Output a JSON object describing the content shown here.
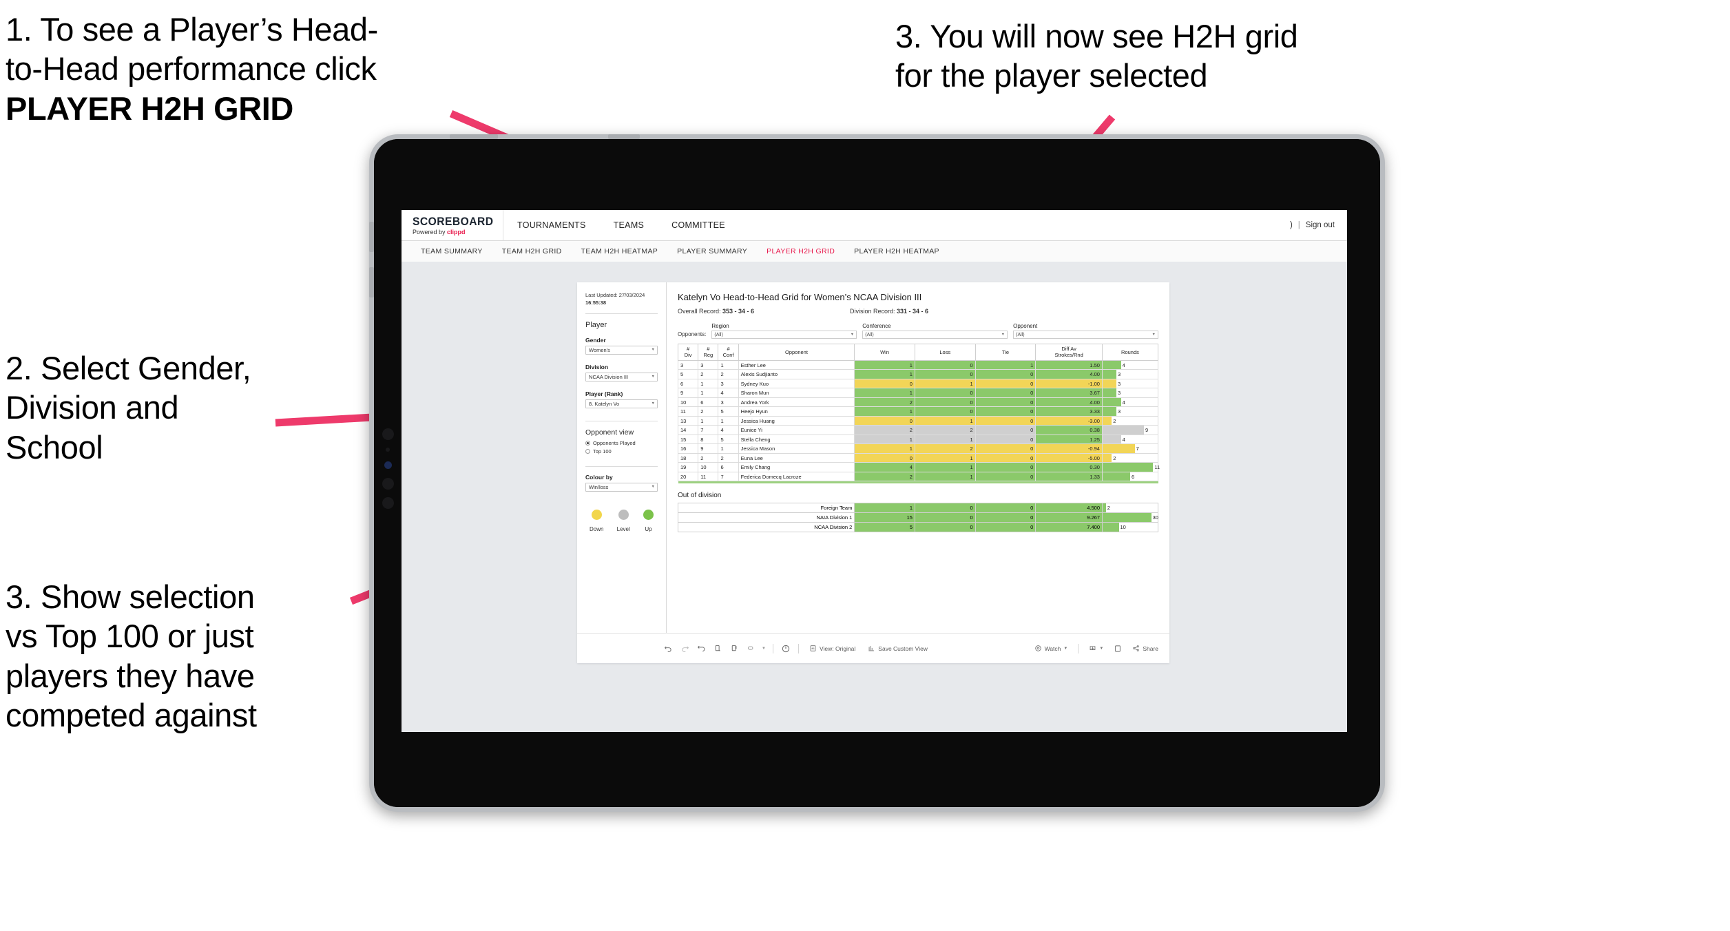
{
  "annotations": {
    "a1_line1": "1. To see a Player’s Head-",
    "a1_line2": "to-Head performance click",
    "a1_bold": "PLAYER H2H GRID",
    "a2": "2. Select Gender,\nDivision and\nSchool",
    "a3": "3. Show selection\nvs Top 100 or just\nplayers they have\ncompeted against",
    "a4": "3. You will now see H2H grid\nfor the player selected",
    "arrow_color": "#EE3A6B"
  },
  "app": {
    "logo": {
      "main": "SCOREBOARD",
      "powered": "Powered by ",
      "brand": "clippd"
    },
    "topnav": [
      {
        "label": "TOURNAMENTS"
      },
      {
        "label": "TEAMS"
      },
      {
        "label": "COMMITTEE"
      }
    ],
    "account": {
      "name": ")",
      "separator": "|",
      "signout": "Sign out"
    },
    "subnav": [
      {
        "label": "TEAM SUMMARY",
        "active": false
      },
      {
        "label": "TEAM H2H GRID",
        "active": false
      },
      {
        "label": "TEAM H2H HEATMAP",
        "active": false
      },
      {
        "label": "PLAYER SUMMARY",
        "active": false
      },
      {
        "label": "PLAYER H2H GRID",
        "active": true
      },
      {
        "label": "PLAYER H2H HEATMAP",
        "active": false
      }
    ]
  },
  "sidebar": {
    "last_updated_label": "Last Updated: 27/03/2024",
    "last_updated_time": "16:55:38",
    "player_heading": "Player",
    "gender_label": "Gender",
    "gender_value": "Women's",
    "division_label": "Division",
    "division_value": "NCAA Division III",
    "player_rank_label": "Player (Rank)",
    "player_rank_value": "8. Katelyn Vo",
    "opponent_view_heading": "Opponent view",
    "opponent_view_options": [
      {
        "label": "Opponents Played",
        "selected": true
      },
      {
        "label": "Top 100",
        "selected": false
      }
    ],
    "colour_by_label": "Colour by",
    "colour_by_value": "Win/loss",
    "legend": [
      {
        "label": "Down",
        "color": "#F2D64B"
      },
      {
        "label": "Level",
        "color": "#BDBDBD"
      },
      {
        "label": "Up",
        "color": "#7BC24A"
      }
    ]
  },
  "viz": {
    "title": "Katelyn Vo Head-to-Head Grid for Women’s NCAA Division III",
    "overall_record_label": "Overall Record: ",
    "overall_record_value": "353 - 34 - 6",
    "division_record_label": "Division Record: ",
    "division_record_value": "331 - 34 - 6",
    "opponents_label": "Opponents:",
    "filters": [
      {
        "label": "Region",
        "value": "(All)"
      },
      {
        "label": "Conference",
        "value": "(All)"
      },
      {
        "label": "Opponent",
        "value": "(All)"
      }
    ],
    "out_of_division_title": "Out of division"
  },
  "chart_data": {
    "type": "table",
    "title": "Katelyn Vo Head-to-Head Grid for Women’s NCAA Division III",
    "columns": [
      "# Div",
      "# Reg",
      "# Conf",
      "Opponent",
      "Win",
      "Loss",
      "Tie",
      "Diff Av Strokes/Rnd",
      "Rounds"
    ],
    "rounds_max": 12,
    "rows": [
      {
        "div": "3",
        "reg": "3",
        "conf": "1",
        "opponent": "Esther Lee",
        "win": "1",
        "loss": "0",
        "tie": "1",
        "diff": "1.50",
        "rounds": "4",
        "state": "up"
      },
      {
        "div": "5",
        "reg": "2",
        "conf": "2",
        "opponent": "Alexis Sudjianto",
        "win": "1",
        "loss": "0",
        "tie": "0",
        "diff": "4.00",
        "rounds": "3",
        "state": "up"
      },
      {
        "div": "6",
        "reg": "1",
        "conf": "3",
        "opponent": "Sydney Kuo",
        "win": "0",
        "loss": "1",
        "tie": "0",
        "diff": "-1.00",
        "rounds": "3",
        "state": "down"
      },
      {
        "div": "9",
        "reg": "1",
        "conf": "4",
        "opponent": "Sharon Mun",
        "win": "1",
        "loss": "0",
        "tie": "0",
        "diff": "3.67",
        "rounds": "3",
        "state": "up"
      },
      {
        "div": "10",
        "reg": "6",
        "conf": "3",
        "opponent": "Andrea York",
        "win": "2",
        "loss": "0",
        "tie": "0",
        "diff": "4.00",
        "rounds": "4",
        "state": "up"
      },
      {
        "div": "11",
        "reg": "2",
        "conf": "5",
        "opponent": "Heejo Hyun",
        "win": "1",
        "loss": "0",
        "tie": "0",
        "diff": "3.33",
        "rounds": "3",
        "state": "up"
      },
      {
        "div": "13",
        "reg": "1",
        "conf": "1",
        "opponent": "Jessica Huang",
        "win": "0",
        "loss": "1",
        "tie": "0",
        "diff": "-3.00",
        "rounds": "2",
        "state": "down"
      },
      {
        "div": "14",
        "reg": "7",
        "conf": "4",
        "opponent": "Eunice Yi",
        "win": "2",
        "loss": "2",
        "tie": "0",
        "diff": "0.38",
        "rounds": "9",
        "state": "level"
      },
      {
        "div": "15",
        "reg": "8",
        "conf": "5",
        "opponent": "Stella Cheng",
        "win": "1",
        "loss": "1",
        "tie": "0",
        "diff": "1.25",
        "rounds": "4",
        "state": "level"
      },
      {
        "div": "16",
        "reg": "9",
        "conf": "1",
        "opponent": "Jessica Mason",
        "win": "1",
        "loss": "2",
        "tie": "0",
        "diff": "-0.94",
        "rounds": "7",
        "state": "down"
      },
      {
        "div": "18",
        "reg": "2",
        "conf": "2",
        "opponent": "Euna Lee",
        "win": "0",
        "loss": "1",
        "tie": "0",
        "diff": "-5.00",
        "rounds": "2",
        "state": "down"
      },
      {
        "div": "19",
        "reg": "10",
        "conf": "6",
        "opponent": "Emily Chang",
        "win": "4",
        "loss": "1",
        "tie": "0",
        "diff": "0.30",
        "rounds": "11",
        "state": "up"
      },
      {
        "div": "20",
        "reg": "11",
        "conf": "7",
        "opponent": "Federica Domecq Lacroze",
        "win": "2",
        "loss": "1",
        "tie": "0",
        "diff": "1.33",
        "rounds": "6",
        "state": "up"
      }
    ],
    "out_of_division": [
      {
        "name": "Foreign Team",
        "win": "1",
        "loss": "0",
        "tie": "0",
        "diff": "4.500",
        "rounds": "2",
        "state": "up"
      },
      {
        "name": "NAIA Division 1",
        "win": "15",
        "loss": "0",
        "tie": "0",
        "diff": "9.267",
        "rounds": "30",
        "state": "up"
      },
      {
        "name": "NCAA Division 2",
        "win": "5",
        "loss": "0",
        "tie": "0",
        "diff": "7.400",
        "rounds": "10",
        "state": "up"
      }
    ],
    "ood_rounds_max": 34,
    "colors": {
      "up": "#8BC96A",
      "down": "#F2D557",
      "level": "#CFCFCF"
    }
  },
  "toolbar": {
    "view_label": "View: Original",
    "save_label": "Save Custom View",
    "watch_label": "Watch",
    "share_label": "Share"
  }
}
